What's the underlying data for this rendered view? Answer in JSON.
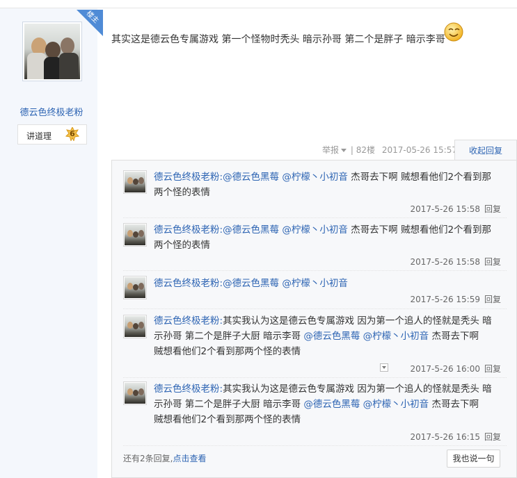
{
  "post": {
    "badge_text": "楼主",
    "author_name": "德云色终极老粉",
    "level_label": "讲道理",
    "level_number": "6",
    "content": "其实这是德云色专属游戏 第一个怪物时秃头 暗示孙哥 第二个是胖子 暗示李哥",
    "emoji_icon": "smiley-face",
    "tail": {
      "report_label": "举报",
      "floor": "82楼",
      "datetime": "2017-05-26 15:57",
      "collapse_label": "收起回复",
      "separator": "|"
    }
  },
  "replies": [
    {
      "user": "德云色终极老粉:",
      "mentions": [
        "@德云色黑莓",
        "@柠檬丶小初音"
      ],
      "line1_after": " 杰哥去下啊 贼想看他们2个看到那",
      "line2": "两个怪的表情",
      "time": "2017-5-26 15:58",
      "reply_label": "回复"
    },
    {
      "user": "德云色终极老粉:",
      "mentions": [
        "@德云色黑莓",
        "@柠檬丶小初音"
      ],
      "line1_after": " 杰哥去下啊 贼想看他们2个看到那",
      "line2": "两个怪的表情",
      "time": "2017-5-26 15:58",
      "reply_label": "回复"
    },
    {
      "user": "德云色终极老粉:",
      "mentions": [
        "@德云色黑莓",
        "@柠檬丶小初音"
      ],
      "time": "2017-5-26 15:59",
      "reply_label": "回复"
    },
    {
      "user": "德云色终极老粉:",
      "line1": "其实我认为这是德云色专属游戏 因为第一个追人的怪就是秃头 暗",
      "line2_before": "示孙哥 第二个是胖子大厨 暗示李哥 ",
      "mentions": [
        "@德云色黑莓",
        "@柠檬丶小初音"
      ],
      "line2_after": " 杰哥去下啊",
      "line3": "贼想看他们2个看到那两个怪的表情",
      "time": "2017-5-26 16:00",
      "reply_label": "回复"
    },
    {
      "user": "德云色终极老粉:",
      "line1": "其实我认为这是德云色专属游戏 因为第一个追人的怪就是秃头 暗",
      "line2_before": "示孙哥 第二个是胖子大厨 暗示李哥 ",
      "mentions": [
        "@德云色黑莓",
        "@柠檬丶小初音"
      ],
      "line2_after": " 杰哥去下啊",
      "line3": "贼想看他们2个看到那两个怪的表情",
      "time": "2017-5-26 16:15",
      "reply_label": "回复"
    }
  ],
  "footer": {
    "more_prefix": "还有2条回复,",
    "more_link": "点击查看",
    "say_button": "我也说一句"
  },
  "colors": {
    "link": "#2d64b3",
    "sidebar_bg": "#f4f7fc",
    "badge_blue": "#4f8bd6",
    "panel_bg": "#f7f8fa"
  }
}
